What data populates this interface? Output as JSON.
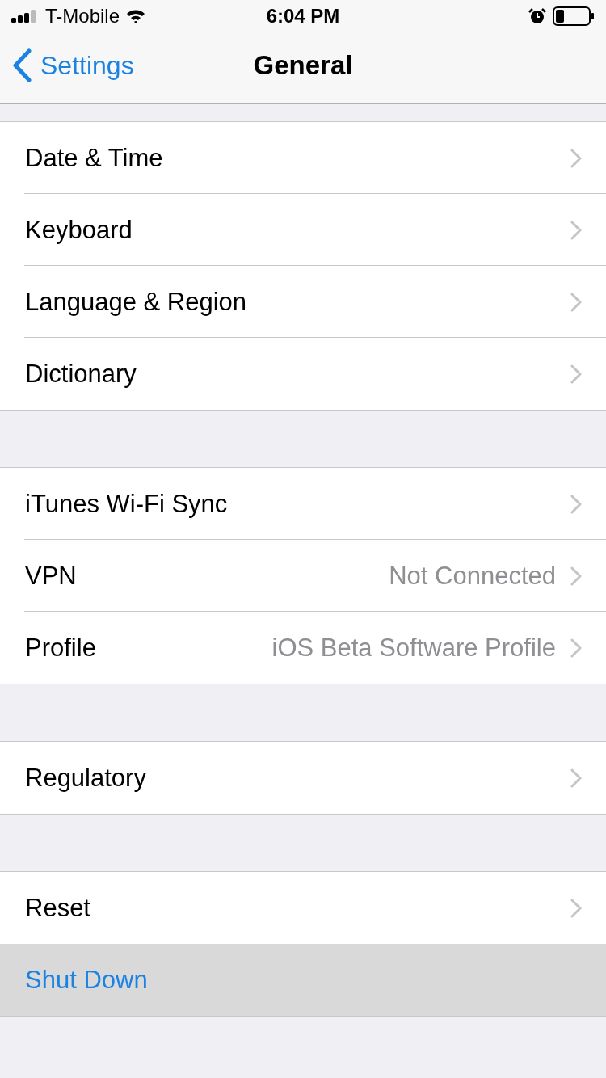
{
  "status_bar": {
    "carrier": "T-Mobile",
    "time": "6:04 PM"
  },
  "nav": {
    "back": "Settings",
    "title": "General"
  },
  "groups": [
    {
      "rows": [
        {
          "kind": "nav",
          "label": "Date & Time",
          "highlighted": false
        },
        {
          "kind": "nav",
          "label": "Keyboard",
          "highlighted": false
        },
        {
          "kind": "nav",
          "label": "Language & Region",
          "highlighted": false
        },
        {
          "kind": "nav",
          "label": "Dictionary",
          "highlighted": false
        }
      ]
    },
    {
      "rows": [
        {
          "kind": "nav",
          "label": "iTunes Wi-Fi Sync",
          "highlighted": false
        },
        {
          "kind": "nav",
          "label": "VPN",
          "detail": "Not Connected",
          "highlighted": false
        },
        {
          "kind": "nav",
          "label": "Profile",
          "detail": "iOS Beta Software Profile",
          "highlighted": false
        }
      ]
    },
    {
      "rows": [
        {
          "kind": "nav",
          "label": "Regulatory",
          "highlighted": false
        }
      ]
    },
    {
      "rows": [
        {
          "kind": "nav",
          "label": "Reset",
          "highlighted": false
        },
        {
          "kind": "action",
          "label": "Shut Down",
          "highlighted": true
        }
      ]
    }
  ]
}
